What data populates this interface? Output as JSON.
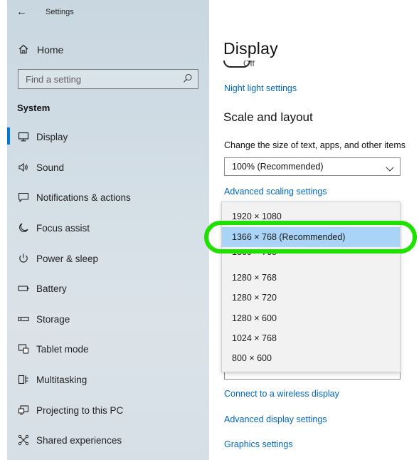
{
  "window": {
    "title": "Settings"
  },
  "sidebar": {
    "home_label": "Home",
    "search_placeholder": "Find a setting",
    "section_title": "System",
    "items": [
      {
        "label": "Display",
        "icon": "monitor-icon",
        "active": true
      },
      {
        "label": "Sound",
        "icon": "speaker-icon"
      },
      {
        "label": "Notifications & actions",
        "icon": "notification-icon"
      },
      {
        "label": "Focus assist",
        "icon": "moon-icon"
      },
      {
        "label": "Power & sleep",
        "icon": "power-icon"
      },
      {
        "label": "Battery",
        "icon": "battery-icon"
      },
      {
        "label": "Storage",
        "icon": "storage-icon"
      },
      {
        "label": "Tablet mode",
        "icon": "tablet-icon"
      },
      {
        "label": "Multitasking",
        "icon": "multitasking-icon"
      },
      {
        "label": "Projecting to this PC",
        "icon": "projector-icon"
      },
      {
        "label": "Shared experiences",
        "icon": "shared-icon"
      }
    ]
  },
  "main": {
    "page_title": "Display",
    "toggle_state": "Off",
    "night_light_link": "Night light settings",
    "scale_heading": "Scale and layout",
    "scale_description": "Change the size of text, apps, and other items",
    "scale_value": "100% (Recommended)",
    "advanced_scaling_link": "Advanced scaling settings",
    "resolution_options": [
      "1920 × 1080",
      "1366 × 768 (Recommended)",
      "1360 × 768",
      "1280 × 768",
      "1280 × 720",
      "1280 × 600",
      "1024 × 768",
      "800 × 600"
    ],
    "selected_resolution_index": 1,
    "wireless_display_link": "Connect to a wireless display",
    "advanced_display_link": "Advanced display settings",
    "graphics_link": "Graphics settings"
  },
  "colors": {
    "accent": "#0078d7",
    "link": "#0067c0",
    "selected_option": "#a9d3f7",
    "annotation_ring": "#1fe000"
  }
}
